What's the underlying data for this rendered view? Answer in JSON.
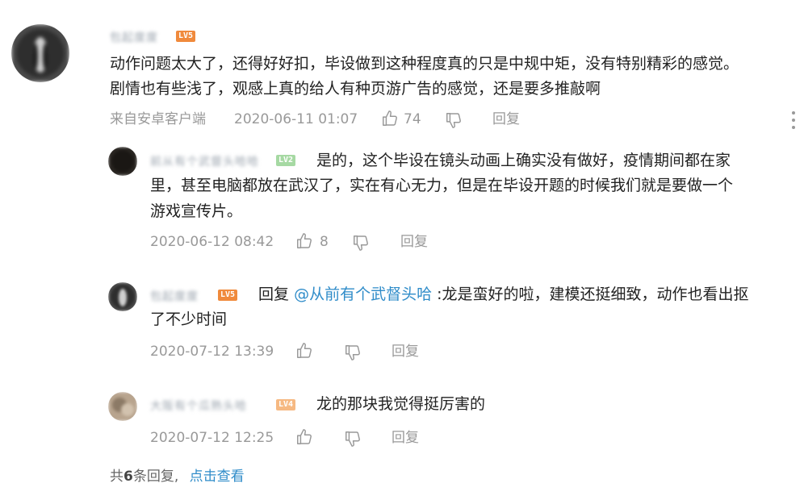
{
  "main_comment": {
    "username": "包起度度",
    "level": "LV5",
    "text_line1": "动作问题太大了，还得好好扣，毕设做到这种程度真的只是中规中矩，没有特别精彩的感觉。",
    "text_line2": "剧情也有些浅了，观感上真的给人有种页游广告的感觉，还是要多推敲啊",
    "source": "来自安卓客户端",
    "time": "2020-06-11 01:07",
    "likes": "74",
    "reply_label": "回复"
  },
  "replies": [
    {
      "username": "前从有个武督头哈哈",
      "level": "LV2",
      "text_line1": "是的，这个毕设在镜头动画上确实没有做好，疫情期间都在家",
      "text_line2": "里，甚至电脑都放在武汉了，实在有心无力，但是在毕设开题的时候我们就是要做一个",
      "text_line3": "游戏宣传片。",
      "time": "2020-06-12 08:42",
      "likes": "8",
      "reply_label": "回复"
    },
    {
      "username": "包起度度",
      "level": "LV5",
      "reply_prefix": "回复",
      "mention": "@从前有个武督头哈",
      "text_line1": ":龙是蛮好的啦，建模还挺细致，动作也看出抠",
      "text_line2": "了不少时间",
      "time": "2020-07-12 13:39",
      "reply_label": "回复"
    },
    {
      "username": "大阪有个瓜熟头哈",
      "level": "LV4",
      "text_line1": "龙的那块我觉得挺厉害的",
      "time": "2020-07-12 12:25",
      "reply_label": "回复"
    }
  ],
  "footer": {
    "total_prefix": "共",
    "total_count": "6",
    "total_suffix": "条回复,",
    "view_link": "点击查看"
  },
  "icons": {
    "like": "thumbs-up-icon",
    "dislike": "thumbs-down-icon",
    "more": "more-vertical-icon"
  },
  "colors": {
    "link": "#2f8cc9",
    "meta": "#999999",
    "lv_orange": "#f08a3c",
    "lv_green": "#a6d9a3"
  }
}
